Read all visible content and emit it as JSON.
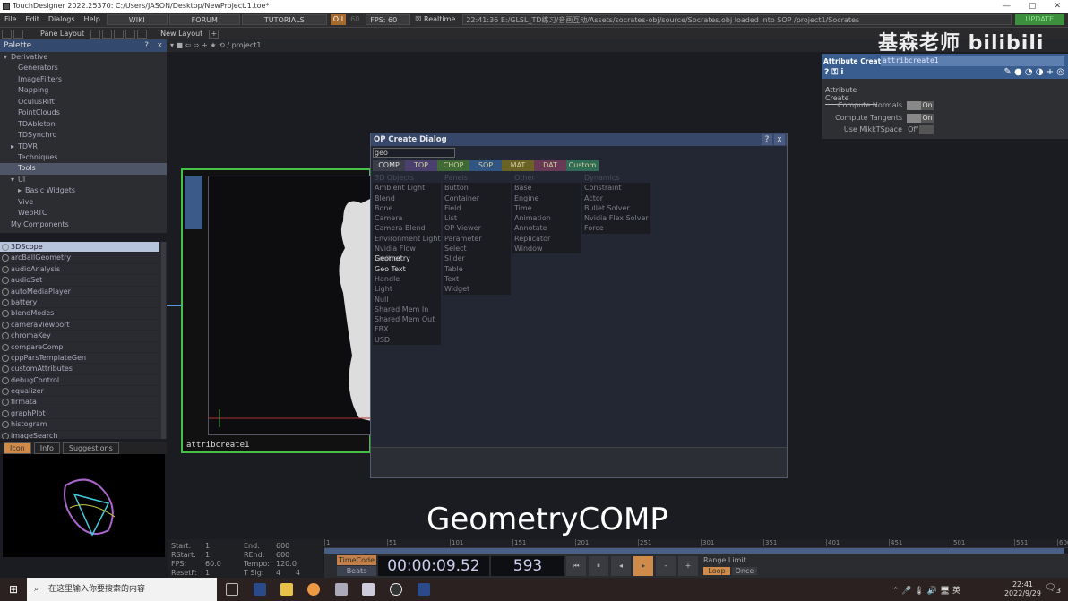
{
  "title": "TouchDesigner 2022.25370: C:/Users/JASON/Desktop/NewProject.1.toe*",
  "menu": [
    "File",
    "Edit",
    "Dialogs",
    "Help"
  ],
  "links": [
    "WIKI",
    "FORUM",
    "TUTORIALS"
  ],
  "oi": "O|I",
  "fps_target": "60",
  "fps": "FPS:  60",
  "realtime": "Realtime",
  "status": "22:41:36 E:/GLSL_TD练习/音画互动/Assets/socrates-obj/source/Socrates.obj loaded into SOP /project1/Socrates",
  "update": "UPDATE",
  "toolbar": {
    "pane_layout": "Pane Layout",
    "new_layout": "New Layout"
  },
  "palette": {
    "title": "Palette",
    "help": "?",
    "close": "x",
    "tree": [
      {
        "l": "Derivative",
        "d": 0,
        "a": "▾"
      },
      {
        "l": "Generators",
        "d": 2
      },
      {
        "l": "ImageFilters",
        "d": 2
      },
      {
        "l": "Mapping",
        "d": 2
      },
      {
        "l": "OculusRift",
        "d": 2
      },
      {
        "l": "PointClouds",
        "d": 2
      },
      {
        "l": "TDAbleton",
        "d": 2
      },
      {
        "l": "TDSynchro",
        "d": 2
      },
      {
        "l": "TDVR",
        "d": 1,
        "a": "▸"
      },
      {
        "l": "Techniques",
        "d": 2
      },
      {
        "l": "Tools",
        "d": 2,
        "sel": 1
      },
      {
        "l": "UI",
        "d": 1,
        "a": "▾"
      },
      {
        "l": "Basic Widgets",
        "d": 2,
        "a": "▸"
      },
      {
        "l": "Vive",
        "d": 2
      },
      {
        "l": "WebRTC",
        "d": 2
      },
      {
        "l": "My Components",
        "d": 1
      }
    ],
    "items": [
      "3DScope",
      "arcBallGeometry",
      "audioAnalysis",
      "audioSet",
      "autoMediaPlayer",
      "battery",
      "blendModes",
      "cameraViewport",
      "chromaKey",
      "compareComp",
      "cppParsTemplateGen",
      "customAttributes",
      "debugControl",
      "equalizer",
      "firmata",
      "graphPlot",
      "histogram",
      "imageSearch"
    ],
    "tabs": [
      "Icon",
      "Info",
      "Suggestions"
    ]
  },
  "network": {
    "path": "/ project1",
    "node": "attribcreate1"
  },
  "dialog": {
    "title": "OP Create Dialog",
    "help": "?",
    "close": "x",
    "search": "geo",
    "tabs": [
      {
        "l": "COMP",
        "c": "#3b3e48"
      },
      {
        "l": "TOP",
        "c": "#4b3f6e"
      },
      {
        "l": "CHOP",
        "c": "#3f6a35"
      },
      {
        "l": "SOP",
        "c": "#2f5580"
      },
      {
        "l": "MAT",
        "c": "#6b6326"
      },
      {
        "l": "DAT",
        "c": "#693a55"
      },
      {
        "l": "Custom",
        "c": "#2f6b55"
      }
    ],
    "columns": [
      {
        "h": "3D Objects",
        "items": [
          "Ambient Light",
          "Blend",
          "Bone",
          "Camera",
          "Camera Blend",
          "Environment Light",
          "Nvidia Flow Emitter",
          "Geometry",
          "Geo Text",
          "Handle",
          "Light",
          "Null",
          "Shared Mem In",
          "Shared Mem Out",
          "FBX",
          "USD"
        ]
      },
      {
        "h": "Panels",
        "items": [
          "Button",
          "Container",
          "Field",
          "List",
          "OP Viewer",
          "Parameter",
          "Select",
          "Slider",
          "Table",
          "Text",
          "Widget"
        ]
      },
      {
        "h": "Other",
        "items": [
          "Base",
          "Engine",
          "Time",
          "Animation",
          "Annotate",
          "Replicator",
          "Window"
        ]
      },
      {
        "h": "Dynamics",
        "items": [
          "Constraint",
          "Actor",
          "Bullet Solver",
          "Nvidia Flex Solver",
          "Force"
        ]
      }
    ],
    "highlight": [
      "Geometry",
      "Geo Text"
    ]
  },
  "attr": {
    "type": "Attribute Create",
    "name": "attribcreate1",
    "page": "Attribute Create",
    "params": [
      {
        "l": "Compute Normals",
        "v": "On"
      },
      {
        "l": "Compute Tangents",
        "v": "On"
      },
      {
        "l": "Use MikkTSpace",
        "v": "Off"
      }
    ]
  },
  "watermark": "基森老师 bilibili",
  "caption": "GeometryCOMP",
  "timeline": {
    "start": "1",
    "end": "600",
    "rstart": "1",
    "rend": "600",
    "fps": "60.0",
    "tempo": "120.0",
    "resetf": "1",
    "tsig1": "4",
    "tsig2": "4",
    "labels": {
      "start": "Start:",
      "end": "End:",
      "rstart": "RStart:",
      "rend": "REnd:",
      "fps": "FPS:",
      "tempo": "Tempo:",
      "resetf": "ResetF:",
      "tsig": "T Sig:"
    },
    "ticks": [
      "1",
      "51",
      "101",
      "151",
      "201",
      "251",
      "301",
      "351",
      "401",
      "451",
      "501",
      "551",
      "600"
    ],
    "timecode_btn": "TimeCode",
    "beats_btn": "Beats",
    "timecode": "00:00:09.52",
    "frame": "593",
    "range_limit": "Range Limit",
    "loop": "Loop",
    "once": "Once"
  },
  "taskbar": {
    "search": "在这里输入你要搜索的内容",
    "time": "22:41",
    "date": "2022/9/29",
    "ime": "英",
    "notif": "3"
  }
}
